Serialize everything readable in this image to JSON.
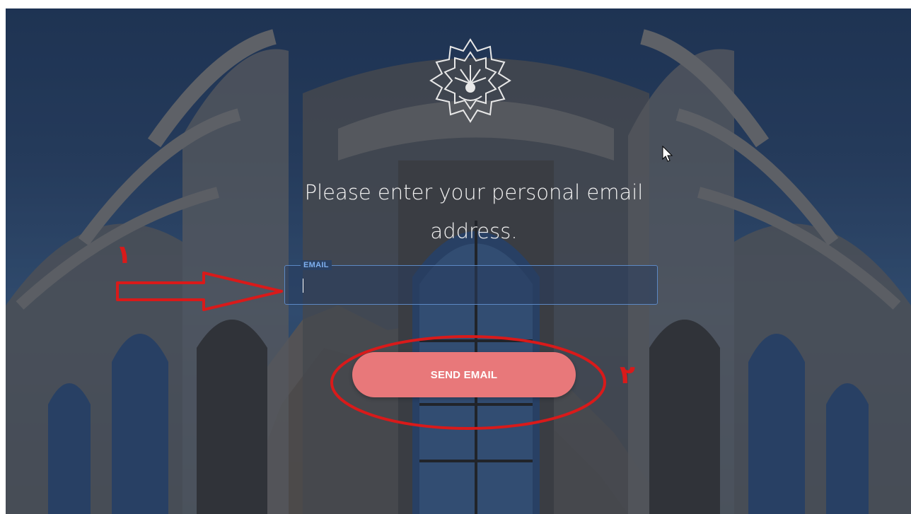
{
  "page": {
    "prompt_text": "Please enter your personal email address."
  },
  "logo": {
    "icon": "university-star-emblem-icon"
  },
  "email": {
    "legend": "EMAIL",
    "value": "",
    "placeholder": ""
  },
  "send_button": {
    "label": "SEND EMAIL"
  },
  "annotations": {
    "step1_label": "١",
    "step2_label": "٢",
    "color": "#d91a1a"
  },
  "colors": {
    "button": "#e8787a",
    "field_border": "#5c88c4",
    "legend_text": "#7fb0f0"
  }
}
